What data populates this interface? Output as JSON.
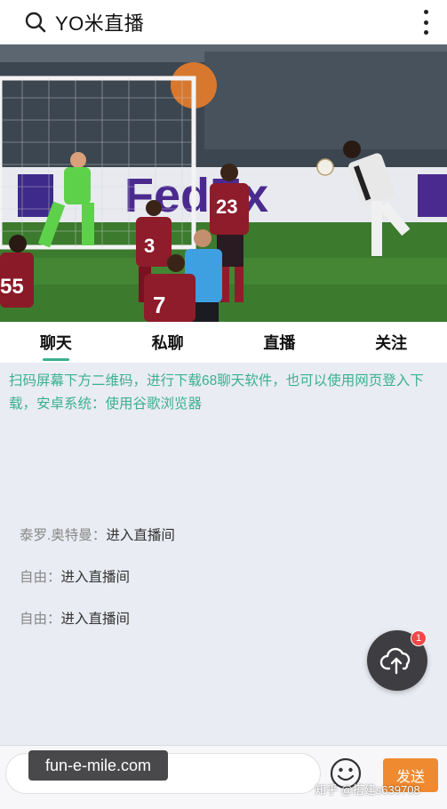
{
  "header": {
    "title": "YO米直播"
  },
  "tabs": [
    {
      "label": "聊天",
      "active": true
    },
    {
      "label": "私聊",
      "active": false
    },
    {
      "label": "直播",
      "active": false
    },
    {
      "label": "关注",
      "active": false
    }
  ],
  "video": {
    "jerseys": {
      "p55": "55",
      "p3": "3",
      "p23": "23",
      "p7": "7"
    },
    "ad_text": "FedEx"
  },
  "chat": {
    "notice": "扫码屏幕下方二维码，进行下载68聊天软件，也可以使用网页登入下载，安卓系统：使用谷歌浏览器",
    "messages": [
      {
        "user": "泰罗.奥特曼：",
        "text": "进入直播间"
      },
      {
        "user": "自由：",
        "text": "进入直播间"
      },
      {
        "user": "自由：",
        "text": "进入直播间"
      }
    ]
  },
  "fab": {
    "badge": "1"
  },
  "composer": {
    "send_label": "发送"
  },
  "watermarks": {
    "site": "fun-e-mile.com",
    "zhihu": "知乎 @搭建s639708"
  },
  "colors": {
    "accent": "#3bb08f",
    "send": "#f08a30",
    "badge": "#f04848"
  },
  "icons": {
    "search": "search-icon",
    "more": "more-vertical-icon",
    "upload": "cloud-upload-icon",
    "emoji": "emoji-icon"
  }
}
